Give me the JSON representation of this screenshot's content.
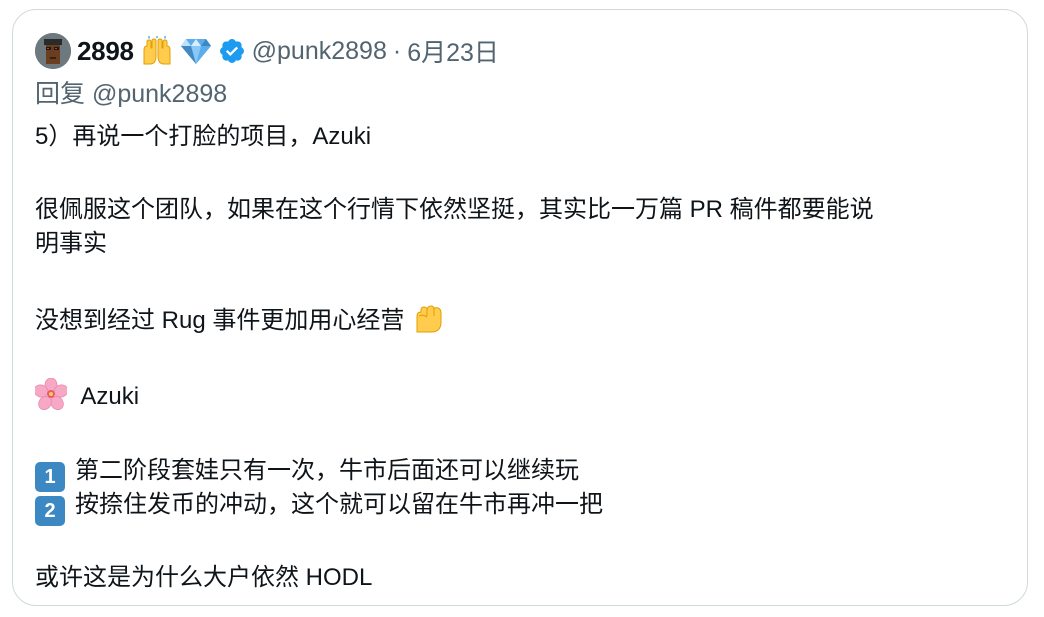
{
  "tweet": {
    "display_name": "2898",
    "name_emojis": [
      "raising-hands-icon",
      "gem-icon"
    ],
    "handle": "@punk2898",
    "separator": "·",
    "date": "6月23日",
    "reply_prefix": "回复",
    "reply_to": "@punk2898",
    "lines": {
      "l1": "5）再说一个打脸的项目，Azuki",
      "l2": "很佩服这个团队，如果在这个行情下依然坚挺，其实比一万篇 PR 稿件都要能说",
      "l3": "明事实",
      "l4": "没想到经过 Rug 事件更加用心经营",
      "l5": "Azuki",
      "l6_key": "1",
      "l6": "第二阶段套娃只有一次，牛市后面还可以继续玩",
      "l7_key": "2",
      "l7": "按捺住发币的冲动，这个就可以留在牛市再冲一把",
      "l8": "或许这是为什么大户依然 HODL"
    }
  },
  "colors": {
    "verified": "#1d9bf0",
    "secondary_text": "#536471",
    "keycap": "#3b88c3",
    "border": "#cfd9de"
  }
}
